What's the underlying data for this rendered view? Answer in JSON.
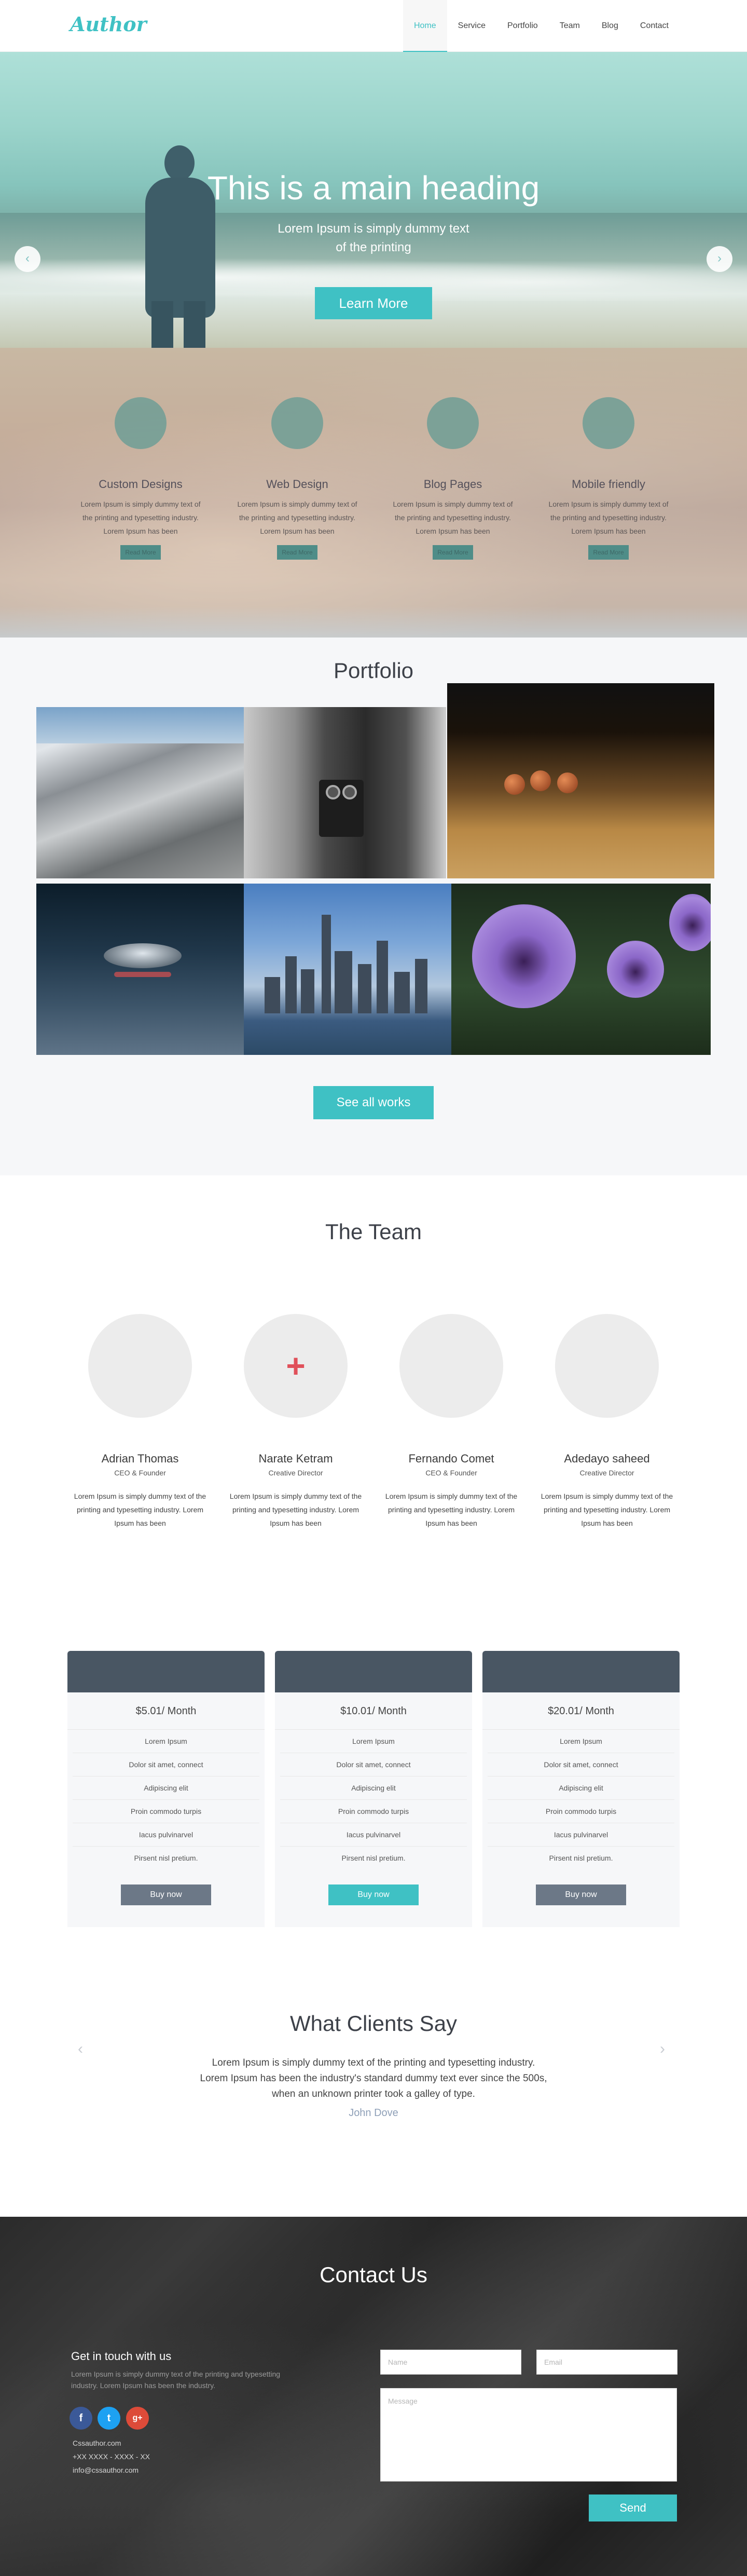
{
  "header": {
    "logo": "Author",
    "nav": [
      "Home",
      "Service",
      "Portfolio",
      "Team",
      "Blog",
      "Contact"
    ],
    "active": "Home"
  },
  "hero": {
    "heading": "This is a main heading",
    "sub_line1": "Lorem Ipsum is simply dummy text",
    "sub_line2": "of the printing",
    "button": "Learn More",
    "prev": "‹",
    "next": "›"
  },
  "services": [
    {
      "title": "Custom Designs",
      "text": "Lorem Ipsum is simply dummy text of the printing and typesetting industry. Lorem Ipsum has been",
      "button": "Read More"
    },
    {
      "title": "Web Design",
      "text": "Lorem Ipsum is simply dummy text of the printing and typesetting industry. Lorem Ipsum has been",
      "button": "Read More"
    },
    {
      "title": "Blog Pages",
      "text": "Lorem Ipsum is simply dummy text of the printing and typesetting industry. Lorem Ipsum has been",
      "button": "Read More"
    },
    {
      "title": "Mobile friendly",
      "text": "Lorem Ipsum is simply dummy text of the printing and typesetting industry. Lorem Ipsum has been",
      "button": "Read More"
    }
  ],
  "portfolio": {
    "title": "Portfolio",
    "button": "See all works"
  },
  "team": {
    "title": "The Team",
    "members": [
      {
        "name": "Adrian Thomas",
        "role": "CEO & Founder",
        "text": "Lorem Ipsum is simply dummy text of the printing and typesetting industry. Lorem Ipsum has been"
      },
      {
        "name": "Narate Ketram",
        "role": "Creative Director",
        "text": "Lorem Ipsum is simply dummy text of the printing and typesetting industry. Lorem Ipsum has been"
      },
      {
        "name": "Fernando Comet",
        "role": "CEO & Founder",
        "text": "Lorem Ipsum is simply dummy text of the printing and typesetting industry. Lorem Ipsum has been"
      },
      {
        "name": "Adedayo saheed",
        "role": "Creative Director",
        "text": "Lorem Ipsum is simply dummy text of the printing and typesetting industry. Lorem Ipsum has been"
      }
    ]
  },
  "pricing": {
    "features": [
      "Lorem Ipsum",
      "Dolor sit amet, connect",
      "Adipiscing elit",
      "Proin commodo turpis",
      "Iacus pulvinarvel",
      "Pirsent nisl pretium."
    ],
    "plans": [
      {
        "price": "$5.01/ Month",
        "button": "Buy now"
      },
      {
        "price": "$10.01/ Month",
        "button": "Buy now"
      },
      {
        "price": "$20.01/ Month",
        "button": "Buy now"
      }
    ]
  },
  "testimonials": {
    "title": "What Clients Say",
    "quote": "Lorem Ipsum is simply dummy text of the printing and typesetting industry. Lorem Ipsum has been the industry's standard dummy text ever since the 500s, when an unknown printer took a galley of type.",
    "author": "John Dove",
    "prev": "‹",
    "next": "›"
  },
  "contact": {
    "title": "Contact Us",
    "subtitle": "Get in touch with us",
    "text": "Lorem Ipsum is simply dummy text of the printing and typesetting industry. Lorem Ipsum has been the industry.",
    "website": "Cssauthor.com",
    "phone": "+XX XXXX - XXXX - XX",
    "email": "info@cssauthor.com",
    "name_placeholder": "Name",
    "email_placeholder": "Email",
    "message_placeholder": "Message",
    "send": "Send"
  },
  "colors": {
    "accent": "#3fc1c4",
    "dark": "#495663"
  }
}
